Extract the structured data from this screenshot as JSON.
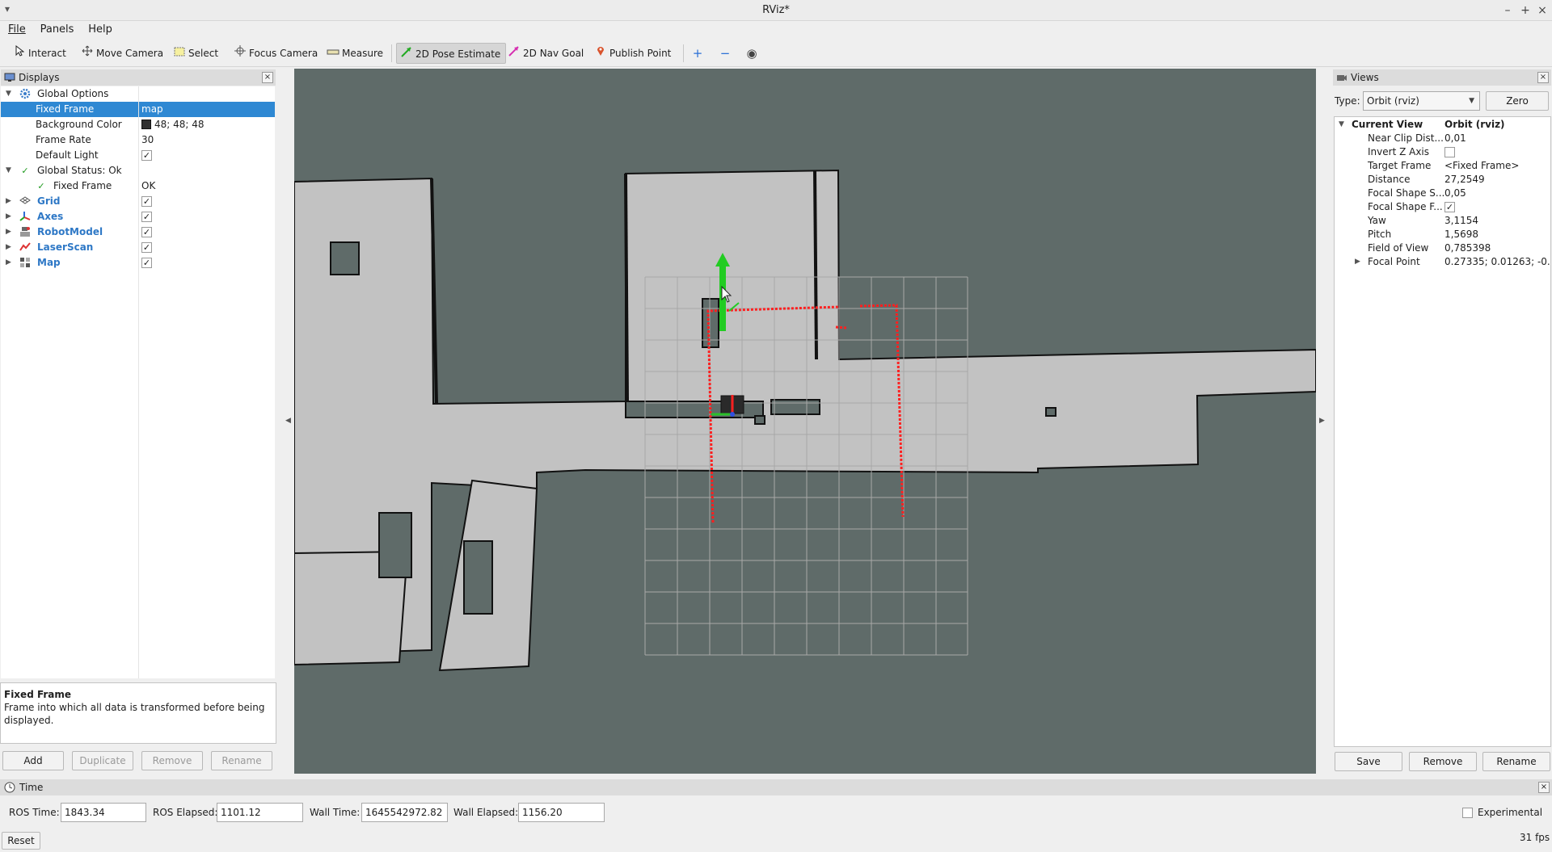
{
  "window": {
    "title": "RViz*",
    "menu_glyph": "▾",
    "minimize": "–",
    "maximize": "+",
    "close": "×"
  },
  "menu": [
    "File",
    "Panels",
    "Help"
  ],
  "toolbar": {
    "tools": [
      "Interact",
      "Move Camera",
      "Select",
      "Focus Camera",
      "Measure",
      "2D Pose Estimate",
      "2D Nav Goal",
      "Publish Point"
    ],
    "active_tool": "2D Pose Estimate",
    "extra_icons": [
      "plus-icon",
      "minus-icon",
      "eye-icon"
    ],
    "plus_glyph": "+",
    "minus_glyph": "−",
    "eye_glyph": "◉"
  },
  "displays": {
    "title": "Displays",
    "close": "×",
    "rows": [
      {
        "label": "Global Options",
        "value": ""
      },
      {
        "label": "Fixed Frame",
        "value": "map"
      },
      {
        "label": "Background Color",
        "value": "48; 48; 48"
      },
      {
        "label": "Frame Rate",
        "value": "30"
      },
      {
        "label": "Default Light",
        "value": ""
      },
      {
        "label": "Global Status: Ok",
        "value": ""
      },
      {
        "label": "Fixed Frame",
        "value": "OK"
      },
      {
        "label": "Grid",
        "value": ""
      },
      {
        "label": "Axes",
        "value": ""
      },
      {
        "label": "RobotModel",
        "value": ""
      },
      {
        "label": "LaserScan",
        "value": ""
      },
      {
        "label": "Map",
        "value": ""
      }
    ],
    "check_glyph": "✓",
    "description_title": "Fixed Frame",
    "description_text": "Frame into which all data is transformed before being displayed.",
    "buttons": [
      "Add",
      "Duplicate",
      "Remove",
      "Rename"
    ]
  },
  "views": {
    "title": "Views",
    "close": "×",
    "type_label": "Type:",
    "type_value": "Orbit (rviz)",
    "zero_label": "Zero",
    "current_view": {
      "label": "Current View",
      "value": "Orbit (rviz)"
    },
    "properties": [
      {
        "label": "Near Clip Dist...",
        "value": "0,01"
      },
      {
        "label": "Invert Z Axis",
        "value": ""
      },
      {
        "label": "Target Frame",
        "value": "<Fixed Frame>"
      },
      {
        "label": "Distance",
        "value": "27,2549"
      },
      {
        "label": "Focal Shape S...",
        "value": "0,05"
      },
      {
        "label": "Focal Shape F...",
        "value": ""
      },
      {
        "label": "Yaw",
        "value": "3,1154"
      },
      {
        "label": "Pitch",
        "value": "1,5698"
      },
      {
        "label": "Field of View",
        "value": "0,785398"
      },
      {
        "label": "Focal Point",
        "value": "0.27335; 0.01263; -0...."
      }
    ],
    "buttons": [
      "Save",
      "Remove",
      "Rename"
    ]
  },
  "time": {
    "title": "Time",
    "close": "×",
    "ros_time_label": "ROS Time:",
    "ros_time": "1843.34",
    "ros_elapsed_label": "ROS Elapsed:",
    "ros_elapsed": "1101.12",
    "wall_time_label": "Wall Time:",
    "wall_time": "1645542972.82",
    "wall_elapsed_label": "Wall Elapsed:",
    "wall_elapsed": "1156.20",
    "experimental_label": "Experimental",
    "reset_label": "Reset",
    "fps": "31 fps"
  },
  "colors": {
    "accent": "#2e88d3",
    "viewport_bg": "#5f6b69",
    "free_space": "#c2c2c2",
    "laser": "#ff2020"
  }
}
